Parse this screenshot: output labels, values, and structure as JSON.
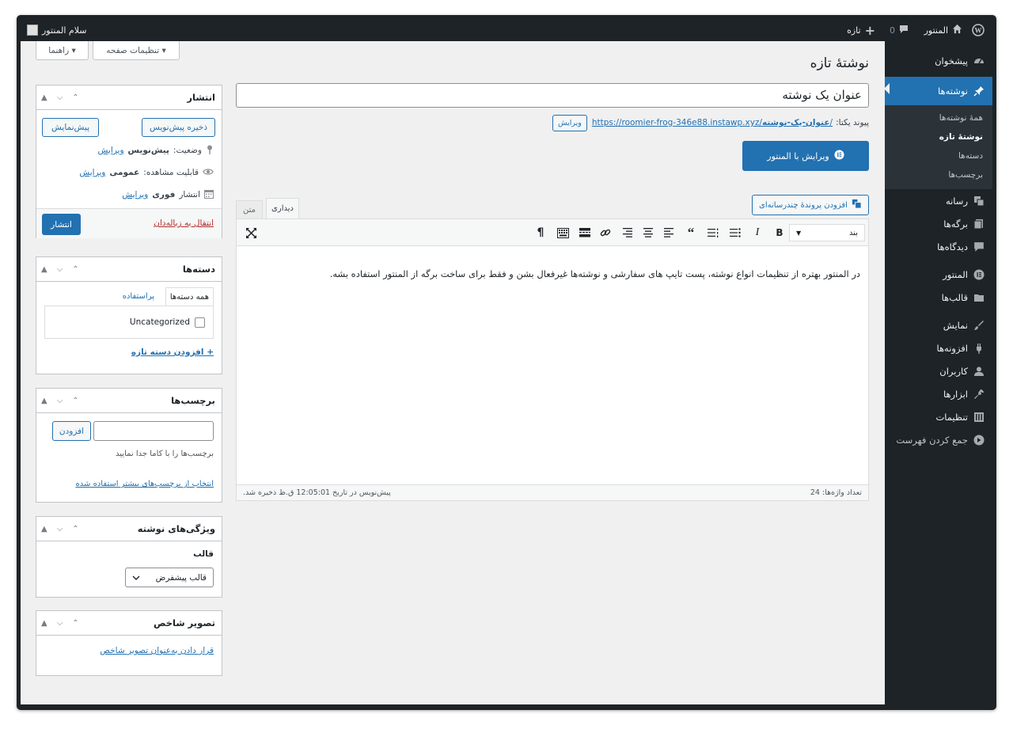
{
  "adminbar": {
    "site_name": "المنتور",
    "comments_count": "0",
    "new_label": "تازه",
    "greeting": "سلام المنتور"
  },
  "menu": {
    "dashboard": "پیشخوان",
    "posts": "نوشته‌ها",
    "posts_sub": [
      "همهٔ نوشته‌ها",
      "نوشتهٔ تازه",
      "دسته‌ها",
      "برچسب‌ها"
    ],
    "media": "رسانه",
    "pages": "برگه‌ها",
    "comments": "دیدگاه‌ها",
    "elementor": "المنتور",
    "templates": "قالب‌ها",
    "appearance": "نمایش",
    "plugins": "افزونه‌ها",
    "users": "کاربران",
    "tools": "ابزارها",
    "settings": "تنظیمات",
    "collapse": "جمع کردن فهرست"
  },
  "screen_options": "تنظیمات صفحه ▾",
  "help": "راهنما ▾",
  "page_title": "نوشتهٔ تازه",
  "post_title": "عنوان یک نوشته",
  "permalink": {
    "label": "پیوند یکتا:",
    "url_base": "https://roomier-frog-346e88.instawp.xyz/",
    "slug": "عنوان-یک-نوشته",
    "edit": "ویرایش"
  },
  "elementor_button": "ویرایش با المنتور",
  "add_media": "افزودن پروندهٔ چندرسانه‌ای",
  "tabs": {
    "visual": "دیداری",
    "text": "متن"
  },
  "format_select": "بند",
  "editor_body": "در المنتور بهتره از تنظیمات انواع نوشته، پست تایپ های سفارشی و نوشته‌ها غیرفعال بشن و فقط برای ساخت برگه از المنتور استفاده بشه.",
  "status_bar": {
    "word_count": "تعداد واژه‌ها: 24",
    "draft_saved": "پیش‌نویس در تاریخ 12:05:01 ق.ظ ذخیره شد."
  },
  "publish_box": {
    "title": "انتشار",
    "save_draft": "ذخیره پیش‌نویس",
    "preview": "پیش‌نمایش",
    "status_label": "وضعیت:",
    "status_value": "پیش‌نویس",
    "visibility_label": "قابلیت مشاهده:",
    "visibility_value": "عمومی",
    "publish_label": "انتشار",
    "publish_value": "فوری",
    "edit": "ویرایش",
    "trash": "انتقال به زباله‌دان",
    "publish_button": "انتشار"
  },
  "categories_box": {
    "title": "دسته‌ها",
    "tab_all": "همه دسته‌ها",
    "tab_popular": "پراستفاده",
    "item": "Uncategorized",
    "add_new": "+ افزودن دسته تازه"
  },
  "tags_box": {
    "title": "برچسب‌ها",
    "add_button": "افزودن",
    "hint": "برچسب‌ها را با کاما جدا نمایید",
    "choose": "انتخاب از برچسب‌های بیشتر استفاده شده"
  },
  "attributes_box": {
    "title": "ویژگی‌های نوشته",
    "template_label": "قالب",
    "template_value": "قالب پیشفرض"
  },
  "featured_box": {
    "title": "تصویر شاخص",
    "set_link": "قرار دادن به‌عنوان تصویر شاخص"
  }
}
